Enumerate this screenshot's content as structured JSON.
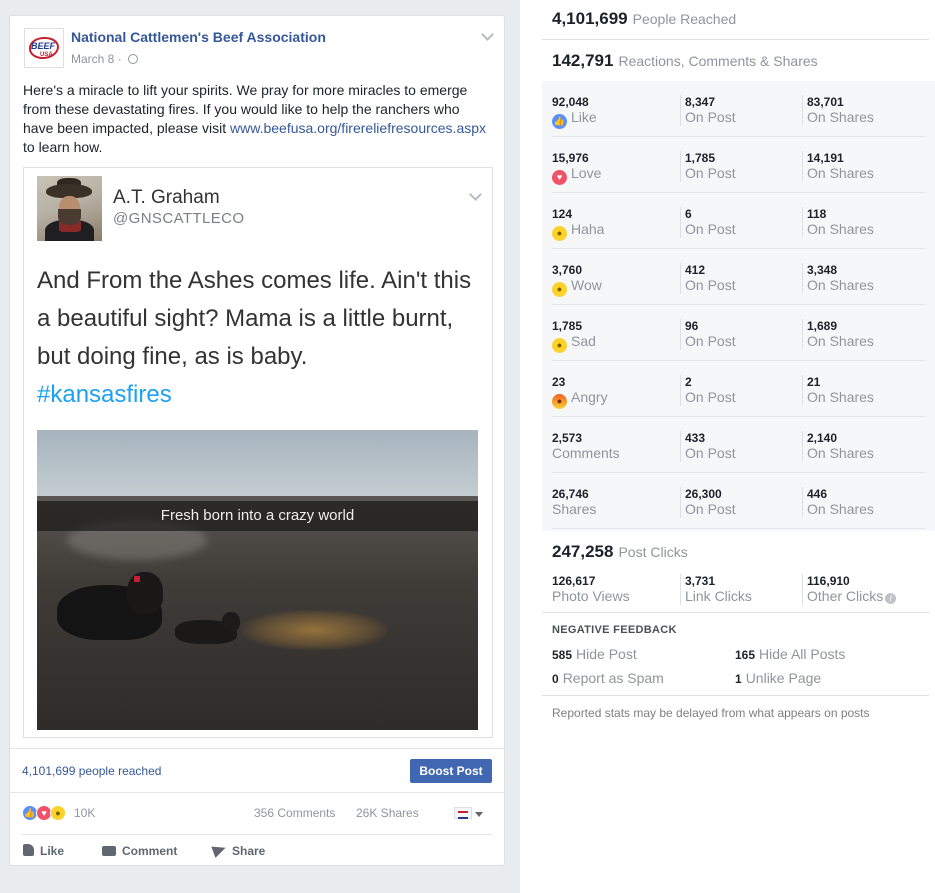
{
  "post": {
    "page_name": "National Cattlemen's Beef Association",
    "page_logo_text": "BEEF",
    "page_logo_sub": "USA",
    "date": "March 8",
    "caption_before_link": "Here's a miracle to lift your spirits. We pray for more miracles to emerge from these devastating fires. If you would like to help the ranchers who have been impacted, please visit ",
    "caption_link": "www.beefusa.org/firereliefresources.aspx",
    "caption_after_link": " to learn how.",
    "embed": {
      "author_name": "A.T. Graham",
      "author_handle": "@GNSCATTLECO",
      "tweet_text": "And From the Ashes comes life. Ain't this a beautiful sight? Mama is a little burnt, but doing fine, as is baby.",
      "hashtag": "#kansasfires",
      "photo_caption": "Fresh born into a crazy world"
    },
    "people_reached": "4,101,699 people reached",
    "boost_label": "Boost Post",
    "reactions_count": "10K",
    "comments_count": "356 Comments",
    "shares_count": "26K Shares",
    "actions": {
      "like": "Like",
      "comment": "Comment",
      "share": "Share"
    }
  },
  "insights": {
    "reached": {
      "value": "4,101,699",
      "label": "People Reached"
    },
    "engagement": {
      "value": "142,791",
      "label": "Reactions, Comments & Shares"
    },
    "breakdown": [
      {
        "icon": "like",
        "total": "92,048",
        "name": "Like",
        "on_post": "8,347",
        "on_shares": "83,701"
      },
      {
        "icon": "love",
        "total": "15,976",
        "name": "Love",
        "on_post": "1,785",
        "on_shares": "14,191"
      },
      {
        "icon": "haha",
        "total": "124",
        "name": "Haha",
        "on_post": "6",
        "on_shares": "118"
      },
      {
        "icon": "wow",
        "total": "3,760",
        "name": "Wow",
        "on_post": "412",
        "on_shares": "3,348"
      },
      {
        "icon": "sad",
        "total": "1,785",
        "name": "Sad",
        "on_post": "96",
        "on_shares": "1,689"
      },
      {
        "icon": "angry",
        "total": "23",
        "name": "Angry",
        "on_post": "2",
        "on_shares": "21"
      },
      {
        "icon": "",
        "total": "2,573",
        "name": "Comments",
        "on_post": "433",
        "on_shares": "2,140"
      },
      {
        "icon": "",
        "total": "26,746",
        "name": "Shares",
        "on_post": "26,300",
        "on_shares": "446"
      }
    ],
    "on_post_label": "On Post",
    "on_shares_label": "On Shares",
    "post_clicks": {
      "value": "247,258",
      "label": "Post Clicks"
    },
    "clicks": [
      {
        "value": "126,617",
        "label": "Photo Views"
      },
      {
        "value": "3,731",
        "label": "Link Clicks"
      },
      {
        "value": "116,910",
        "label": "Other Clicks"
      }
    ],
    "negative_title": "NEGATIVE FEEDBACK",
    "negative": [
      {
        "value": "585",
        "label": "Hide Post"
      },
      {
        "value": "165",
        "label": "Hide All Posts"
      },
      {
        "value": "0",
        "label": "Report as Spam"
      },
      {
        "value": "1",
        "label": "Unlike Page"
      }
    ],
    "footnote": "Reported stats may be delayed from what appears on posts"
  },
  "colors": {
    "link": "#365899",
    "accent": "#4267b2",
    "muted": "#90949c",
    "hashtag": "#1da1f2",
    "background": "#e9ebee"
  }
}
